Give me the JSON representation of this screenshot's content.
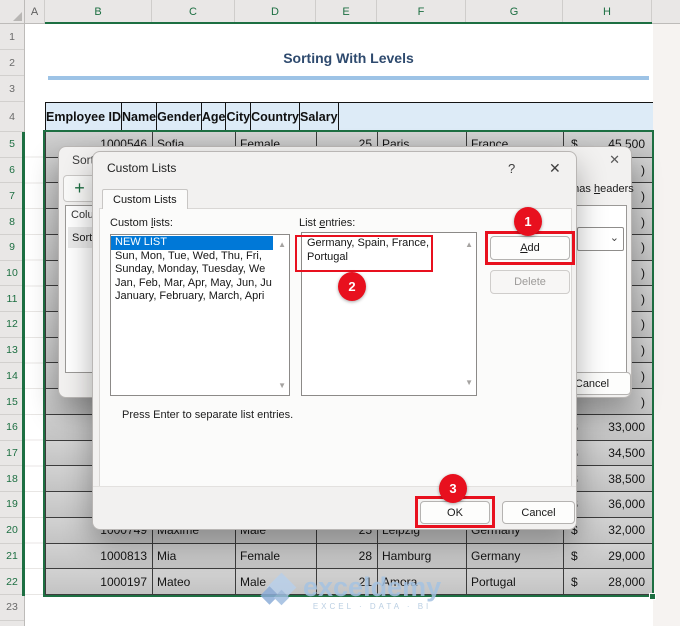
{
  "colors": {
    "xl-green": "#1d6f42",
    "sel-blue": "#0078d7",
    "anno-red": "#e8101e",
    "title-blue": "#2e4a6e",
    "header-fill": "#ddebf7",
    "cell-gray": "#cacaca"
  },
  "spreadsheet": {
    "title": "Sorting With Levels",
    "column_letters": [
      "A",
      "B",
      "C",
      "D",
      "E",
      "F",
      "G",
      "H"
    ],
    "row_numbers": [
      "1",
      "2",
      "3",
      "4",
      "5",
      "6",
      "7",
      "8",
      "9",
      "10",
      "11",
      "12",
      "13",
      "14",
      "15",
      "16",
      "17",
      "18",
      "19",
      "20",
      "21",
      "22",
      "23"
    ],
    "table": {
      "headers": [
        "Employee ID",
        "Name",
        "Gender",
        "Age",
        "City",
        "Country",
        "Salary"
      ],
      "rows": [
        {
          "id": "1000546",
          "name": "Sofia",
          "gender": "Female",
          "age": "25",
          "city": "Paris",
          "country": "France",
          "cur": "$",
          "salary": "45,500"
        },
        {
          "id": "",
          "name": "",
          "gender": "",
          "age": "",
          "city": "",
          "country": "",
          "cur": "",
          "salary": ")"
        },
        {
          "id": "",
          "name": "",
          "gender": "",
          "age": "",
          "city": "",
          "country": "",
          "cur": "",
          "salary": ")"
        },
        {
          "id": "",
          "name": "",
          "gender": "",
          "age": "",
          "city": "",
          "country": "",
          "cur": "",
          "salary": ")"
        },
        {
          "id": "",
          "name": "",
          "gender": "",
          "age": "",
          "city": "",
          "country": "",
          "cur": "",
          "salary": ")"
        },
        {
          "id": "",
          "name": "",
          "gender": "",
          "age": "",
          "city": "",
          "country": "",
          "cur": "",
          "salary": ")"
        },
        {
          "id": "",
          "name": "",
          "gender": "",
          "age": "",
          "city": "",
          "country": "",
          "cur": "",
          "salary": ")"
        },
        {
          "id": "",
          "name": "",
          "gender": "",
          "age": "",
          "city": "",
          "country": "",
          "cur": "",
          "salary": ")"
        },
        {
          "id": "",
          "name": "",
          "gender": "",
          "age": "",
          "city": "",
          "country": "",
          "cur": "",
          "salary": ")"
        },
        {
          "id": "",
          "name": "",
          "gender": "",
          "age": "",
          "city": "",
          "country": "",
          "cur": "",
          "salary": ")"
        },
        {
          "id": "",
          "name": "",
          "gender": "",
          "age": "",
          "city": "",
          "country": "",
          "cur": "",
          "salary": ")"
        },
        {
          "id": "",
          "name": "",
          "gender": "",
          "age": "",
          "city": "",
          "country": "",
          "cur": "$",
          "salary": "33,000"
        },
        {
          "id": "",
          "name": "",
          "gender": "",
          "age": "",
          "city": "",
          "country": "",
          "cur": "$",
          "salary": "34,500"
        },
        {
          "id": "",
          "name": "",
          "gender": "",
          "age": "",
          "city": "",
          "country": "",
          "cur": "$",
          "salary": "38,500"
        },
        {
          "id": "",
          "name": "",
          "gender": "",
          "age": "",
          "city": "",
          "country": "",
          "cur": "$",
          "salary": "36,000"
        },
        {
          "id": "1000749",
          "name": "Maxime",
          "gender": "Male",
          "age": "25",
          "city": "Leipzig",
          "country": "Germany",
          "cur": "$",
          "salary": "32,000"
        },
        {
          "id": "1000813",
          "name": "Mia",
          "gender": "Female",
          "age": "28",
          "city": "Hamburg",
          "country": "Germany",
          "cur": "$",
          "salary": "29,000"
        },
        {
          "id": "1000197",
          "name": "Mateo",
          "gender": "Male",
          "age": "21",
          "city": "Amora",
          "country": "Portugal",
          "cur": "$",
          "salary": "28,000"
        }
      ]
    },
    "watermark": {
      "brand": "exceldemy",
      "tagline": "EXCEL · DATA · BI"
    }
  },
  "sort_dialog": {
    "title": "Sort",
    "close_icon": "✕",
    "add_level_icon": "+",
    "headers_checkbox": {
      "text": "My data has headers",
      "accel": "he"
    },
    "column_header": "Column",
    "sort_by_label": "Sort",
    "order_chevron": "⌄",
    "cancel_label": "Cancel"
  },
  "custom_lists_dialog": {
    "title": "Custom Lists",
    "help_icon": "?",
    "close_icon": "✕",
    "tab_label": "Custom Lists",
    "custom_lists_label": {
      "text": "Custom lists:",
      "accel": "l"
    },
    "list_entries_label": {
      "text": "List entries:",
      "accel": "e"
    },
    "lists": [
      "NEW LIST",
      "Sun, Mon, Tue, Wed, Thu, Fri,",
      "Sunday, Monday, Tuesday, We",
      "Jan, Feb, Mar, Apr, May, Jun, Ju",
      "January, February, March, Apri"
    ],
    "entries_line1": "Germany, Spain, France,",
    "entries_line2": "Portugal",
    "add_label": {
      "text": "Add",
      "accel": "A"
    },
    "delete_label": "Delete",
    "hint": "Press Enter to separate list entries.",
    "ok_label": "OK",
    "cancel_label": "Cancel",
    "scroll_up_icon": "▲",
    "scroll_down_icon": "▼"
  },
  "annotations": {
    "badge1": "1",
    "badge2": "2",
    "badge3": "3"
  }
}
